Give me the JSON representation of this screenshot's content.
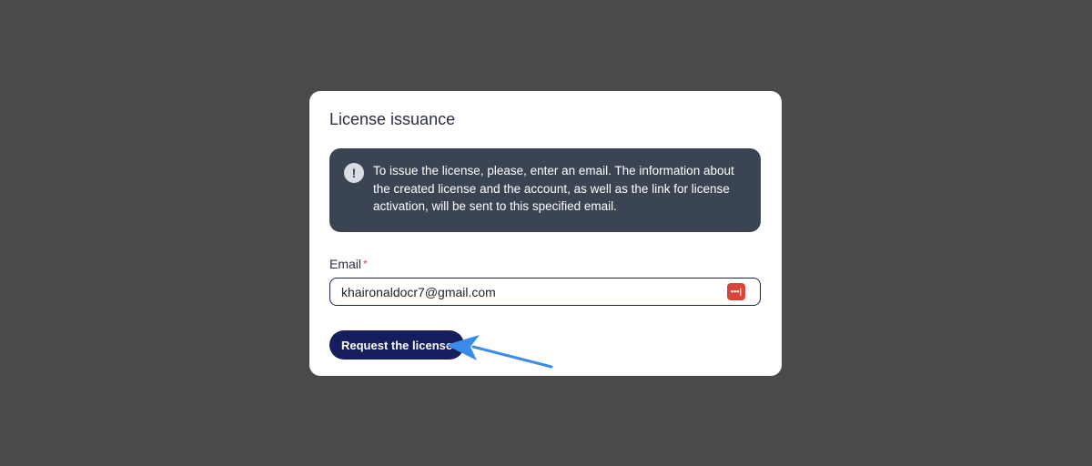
{
  "dialog": {
    "title": "License issuance",
    "info_message": "To issue the license, please, enter an email. The information about the created license and the account, as well as the link for license activation, will be sent to this specified email.",
    "info_icon_glyph": "!"
  },
  "email_field": {
    "label": "Email",
    "required_mark": "*",
    "value": "khaironaldocr7@gmail.com",
    "password_manager_glyph": "•••|"
  },
  "actions": {
    "request_label": "Request the license"
  },
  "colors": {
    "backdrop": "#4a4a4a",
    "info_box": "#3b4452",
    "primary_button": "#151d5c",
    "annotation_arrow": "#3b8be8"
  }
}
